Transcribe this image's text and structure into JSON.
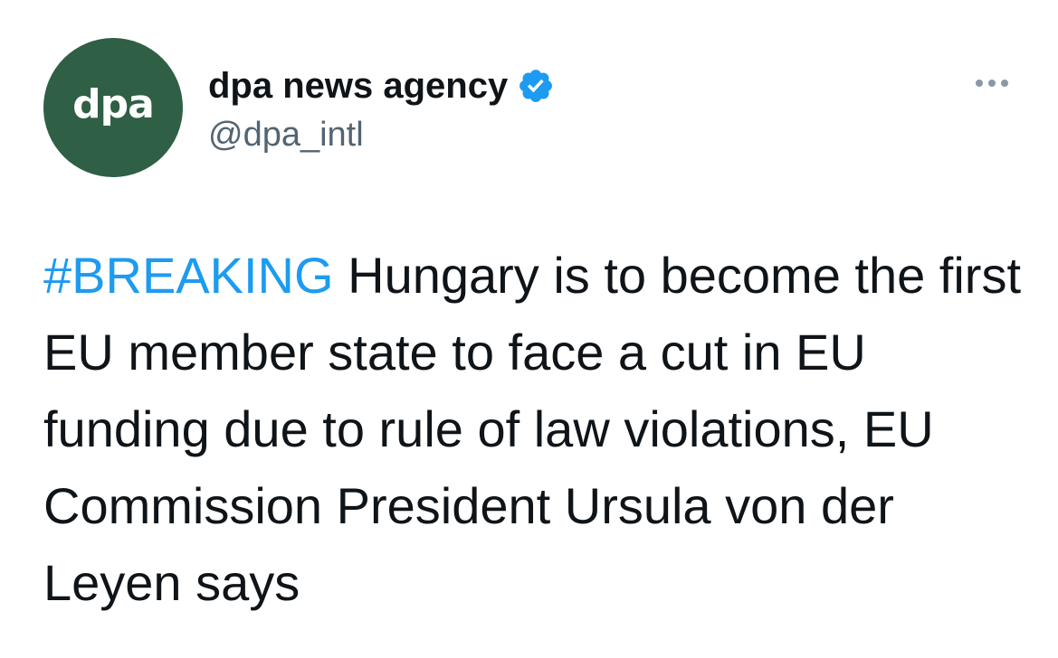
{
  "author": {
    "avatar_text": "dpa",
    "display_name": "dpa news agency",
    "handle": "@dpa_intl",
    "verified": true
  },
  "tweet": {
    "hashtag": "#BREAKING",
    "body": " Hungary is to become the first EU member state to face a cut in EU funding due to rule of law violations, EU Commission President Ursula von der Leyen says"
  },
  "icons": {
    "verified": "verified-badge-icon",
    "more": "more-options-icon"
  },
  "colors": {
    "avatar_bg": "#2f5f45",
    "hashtag": "#1d9bf0",
    "verified": "#1d9bf0",
    "handle": "#536471"
  }
}
